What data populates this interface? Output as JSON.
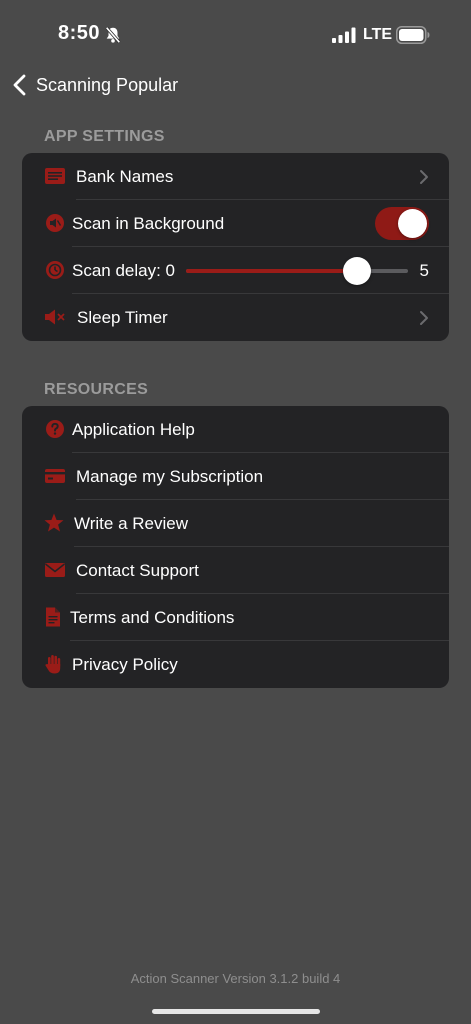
{
  "status_bar": {
    "time": "8:50",
    "network": "LTE"
  },
  "nav": {
    "back_label": "Scanning Popular"
  },
  "app_settings": {
    "header": "APP SETTINGS",
    "bank_names_label": "Bank Names",
    "scan_background_label": "Scan in Background",
    "scan_background_on": true,
    "scan_delay_label": "Scan delay: 0",
    "scan_delay_max": "5",
    "scan_delay_fraction": 0.77,
    "sleep_timer_label": "Sleep Timer"
  },
  "resources": {
    "header": "RESOURCES",
    "items": [
      {
        "label": "Application Help",
        "icon": "help-circle-icon"
      },
      {
        "label": "Manage my Subscription",
        "icon": "credit-card-icon"
      },
      {
        "label": "Write a Review",
        "icon": "star-icon"
      },
      {
        "label": "Contact Support",
        "icon": "envelope-icon"
      },
      {
        "label": "Terms and Conditions",
        "icon": "document-icon"
      },
      {
        "label": "Privacy Policy",
        "icon": "hand-icon"
      }
    ]
  },
  "footer": {
    "version": "Action Scanner Version 3.1.2 build 4"
  },
  "colors": {
    "accent": "#9a1c18",
    "background": "#4a4a4a",
    "group": "#232325"
  }
}
